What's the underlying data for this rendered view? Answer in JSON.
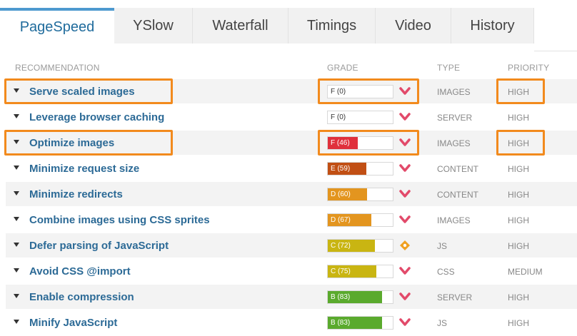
{
  "tabs": [
    {
      "label": "PageSpeed",
      "active": true
    },
    {
      "label": "YSlow",
      "active": false
    },
    {
      "label": "Waterfall",
      "active": false
    },
    {
      "label": "Timings",
      "active": false
    },
    {
      "label": "Video",
      "active": false
    },
    {
      "label": "History",
      "active": false
    }
  ],
  "table": {
    "headers": {
      "recommendation": "RECOMMENDATION",
      "grade": "GRADE",
      "type": "TYPE",
      "priority": "PRIORITY"
    },
    "rows": [
      {
        "recommendation": "Serve scaled images",
        "grade": "F (0)",
        "score": 0,
        "color": "#e0303c",
        "icon": "chevron-down-icon",
        "type": "IMAGES",
        "priority": "HIGH"
      },
      {
        "recommendation": "Leverage browser caching",
        "grade": "F (0)",
        "score": 0,
        "color": "#e0303c",
        "icon": "chevron-down-icon",
        "type": "SERVER",
        "priority": "HIGH"
      },
      {
        "recommendation": "Optimize images",
        "grade": "F (46)",
        "score": 46,
        "color": "#e0303c",
        "icon": "chevron-down-icon",
        "type": "IMAGES",
        "priority": "HIGH"
      },
      {
        "recommendation": "Minimize request size",
        "grade": "E (59)",
        "score": 59,
        "color": "#c14f14",
        "icon": "chevron-down-icon",
        "type": "CONTENT",
        "priority": "HIGH"
      },
      {
        "recommendation": "Minimize redirects",
        "grade": "D (60)",
        "score": 60,
        "color": "#e3951f",
        "icon": "chevron-down-icon",
        "type": "CONTENT",
        "priority": "HIGH"
      },
      {
        "recommendation": "Combine images using CSS sprites",
        "grade": "D (67)",
        "score": 67,
        "color": "#e3951f",
        "icon": "chevron-down-icon",
        "type": "IMAGES",
        "priority": "HIGH"
      },
      {
        "recommendation": "Defer parsing of JavaScript",
        "grade": "C (72)",
        "score": 72,
        "color": "#c9b512",
        "icon": "diamond-icon",
        "type": "JS",
        "priority": "HIGH"
      },
      {
        "recommendation": "Avoid CSS @import",
        "grade": "C (75)",
        "score": 75,
        "color": "#c9b512",
        "icon": "chevron-down-icon",
        "type": "CSS",
        "priority": "MEDIUM"
      },
      {
        "recommendation": "Enable compression",
        "grade": "B (83)",
        "score": 83,
        "color": "#5aaa2d",
        "icon": "chevron-down-icon",
        "type": "SERVER",
        "priority": "HIGH"
      },
      {
        "recommendation": "Minify JavaScript",
        "grade": "B (83)",
        "score": 83,
        "color": "#5aaa2d",
        "icon": "chevron-down-icon",
        "type": "JS",
        "priority": "HIGH"
      }
    ]
  },
  "colors": {
    "highlight": "#f28a1d",
    "link": "#2c6a96",
    "tab_active": "#4d99cf",
    "chevron": "#e24a6a",
    "diamond": "#f0a020"
  }
}
